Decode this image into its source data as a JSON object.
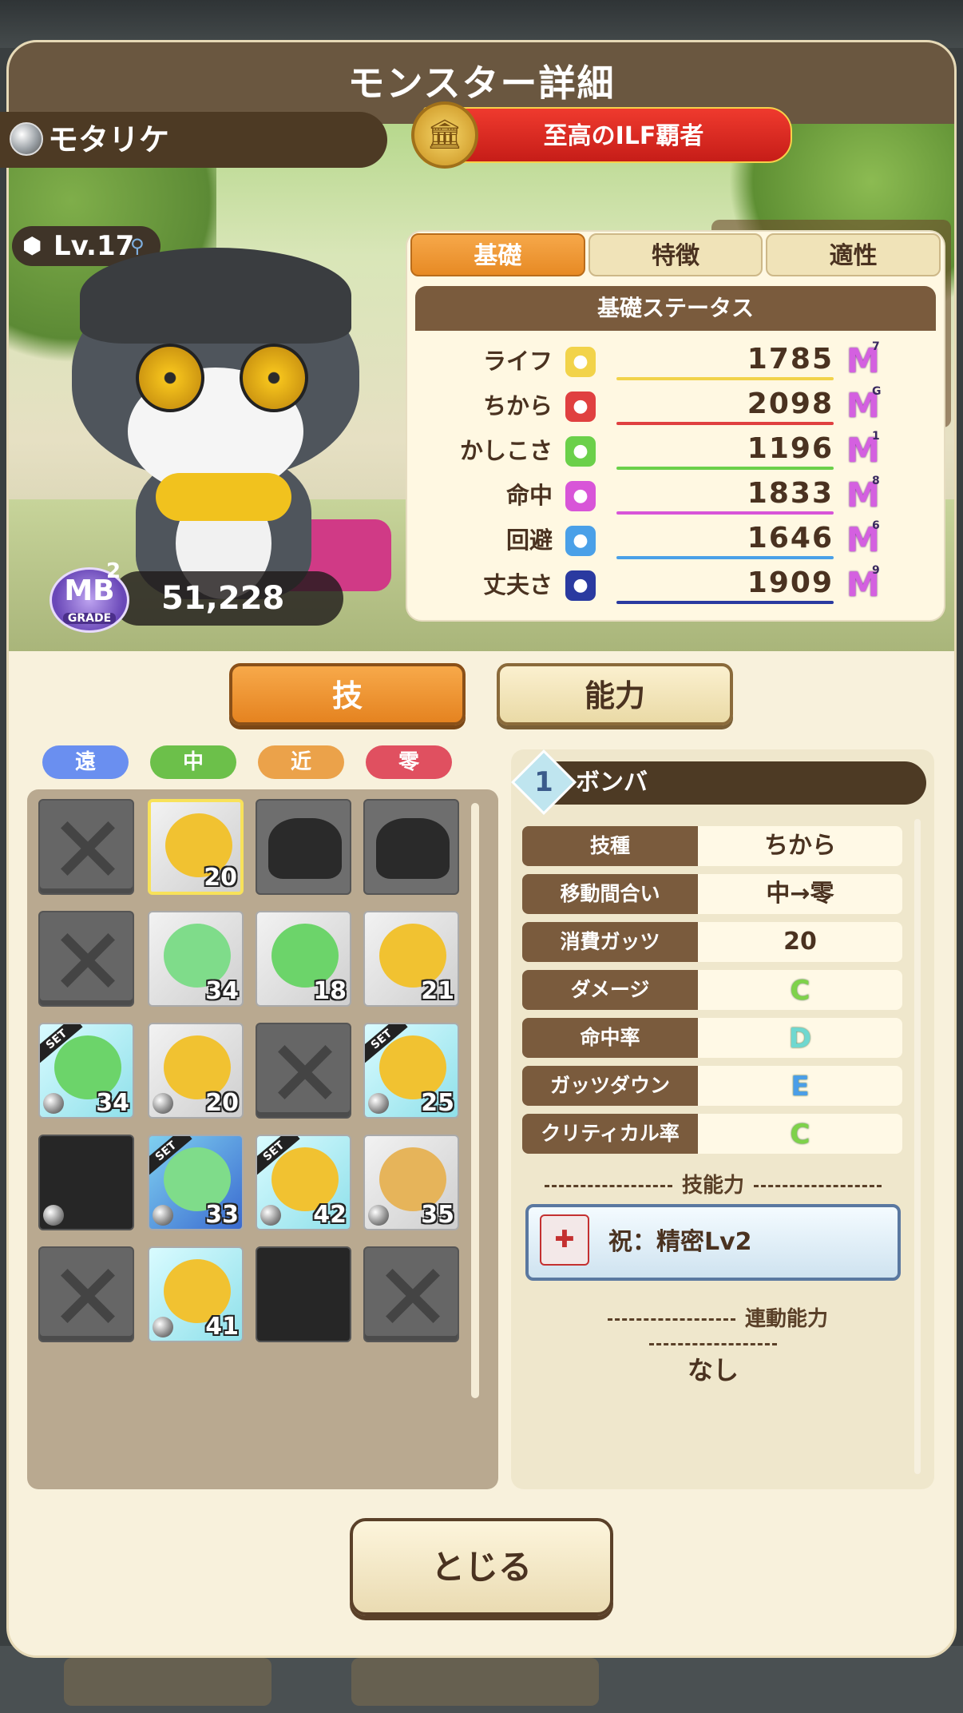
{
  "window": {
    "title": "モンスター詳細"
  },
  "monster": {
    "name": "モタリケ",
    "level": "Lv.17",
    "title_badge": "至高のILF覇者",
    "power": "51,228",
    "grade": {
      "label": "MB",
      "sub": "2",
      "caption": "GRADE"
    }
  },
  "stat_tabs": [
    {
      "label": "基礎",
      "active": true
    },
    {
      "label": "特徴",
      "active": false
    },
    {
      "label": "適性",
      "active": false
    }
  ],
  "stats": {
    "header": "基礎ステータス",
    "rows": [
      {
        "label": "ライフ",
        "value": "1785",
        "icon": "heart-icon",
        "color": "#f2d34a",
        "rank": "7"
      },
      {
        "label": "ちから",
        "value": "2098",
        "icon": "fist-icon",
        "color": "#e04040",
        "rank": "G"
      },
      {
        "label": "かしこさ",
        "value": "1196",
        "icon": "book-icon",
        "color": "#6bd04a",
        "rank": "1"
      },
      {
        "label": "命中",
        "value": "1833",
        "icon": "target-icon",
        "color": "#d855d8",
        "rank": "8"
      },
      {
        "label": "回避",
        "value": "1646",
        "icon": "boot-icon",
        "color": "#4aa0e8",
        "rank": "6"
      },
      {
        "label": "丈夫さ",
        "value": "1909",
        "icon": "shield-icon",
        "color": "#2a3aa0",
        "rank": "9"
      }
    ]
  },
  "mode_buttons": {
    "skills": "技",
    "abilities": "能力"
  },
  "range_filters": [
    {
      "label": "遠",
      "color": "#6a8ff0"
    },
    {
      "label": "中",
      "color": "#6cc04a"
    },
    {
      "label": "近",
      "color": "#eba24a"
    },
    {
      "label": "零",
      "color": "#e05060"
    }
  ],
  "skill_grid": [
    {
      "kind": "locked"
    },
    {
      "kind": "skill",
      "num": "20",
      "selected": true,
      "bg": "plain",
      "art": "#f1c231"
    },
    {
      "kind": "silhouette"
    },
    {
      "kind": "silhouette"
    },
    {
      "kind": "locked"
    },
    {
      "kind": "skill",
      "num": "34",
      "bg": "plain",
      "art": "#7fdc8a"
    },
    {
      "kind": "skill",
      "num": "18",
      "bg": "plain",
      "art": "#6cd46a"
    },
    {
      "kind": "skill",
      "num": "21",
      "bg": "plain",
      "art": "#f1c231"
    },
    {
      "kind": "skill",
      "num": "34",
      "bg": "cyan",
      "art": "#6cd46a",
      "set": true,
      "orb": true
    },
    {
      "kind": "skill",
      "num": "20",
      "bg": "plain",
      "art": "#f1c231",
      "orb": true
    },
    {
      "kind": "locked"
    },
    {
      "kind": "skill",
      "num": "25",
      "bg": "cyan",
      "art": "#f1c231",
      "set": true,
      "orb": true
    },
    {
      "kind": "dark",
      "orb": true
    },
    {
      "kind": "skill",
      "num": "33",
      "bg": "blue",
      "art": "#7fdc8a",
      "set": true,
      "orb": true
    },
    {
      "kind": "skill",
      "num": "42",
      "bg": "cyan",
      "art": "#f1c231",
      "set": true,
      "orb": true
    },
    {
      "kind": "skill",
      "num": "35",
      "bg": "plain",
      "art": "#e6b45a",
      "orb": true
    },
    {
      "kind": "locked"
    },
    {
      "kind": "skill",
      "num": "41",
      "bg": "cyan",
      "art": "#f1c231",
      "orb": true
    },
    {
      "kind": "dark"
    },
    {
      "kind": "locked"
    }
  ],
  "skill_detail": {
    "index": "1",
    "name": "ボンバ",
    "rows": [
      {
        "key": "技種",
        "value": "ちから"
      },
      {
        "key": "移動間合い",
        "value": "中→零"
      },
      {
        "key": "消費ガッツ",
        "value": "20"
      },
      {
        "key": "ダメージ",
        "value": "C",
        "grade_color": "#7ed24a"
      },
      {
        "key": "命中率",
        "value": "D",
        "grade_color": "#6fd8d0"
      },
      {
        "key": "ガッツダウン",
        "value": "E",
        "grade_color": "#4a9ee8"
      },
      {
        "key": "クリティカル率",
        "value": "C",
        "grade_color": "#7ed24a"
      }
    ],
    "skill_ability_header": "技能力",
    "skill_ability": "祝：精密Lv2",
    "linked_header": "連動能力",
    "linked_value": "なし"
  },
  "close_button": "とじる"
}
